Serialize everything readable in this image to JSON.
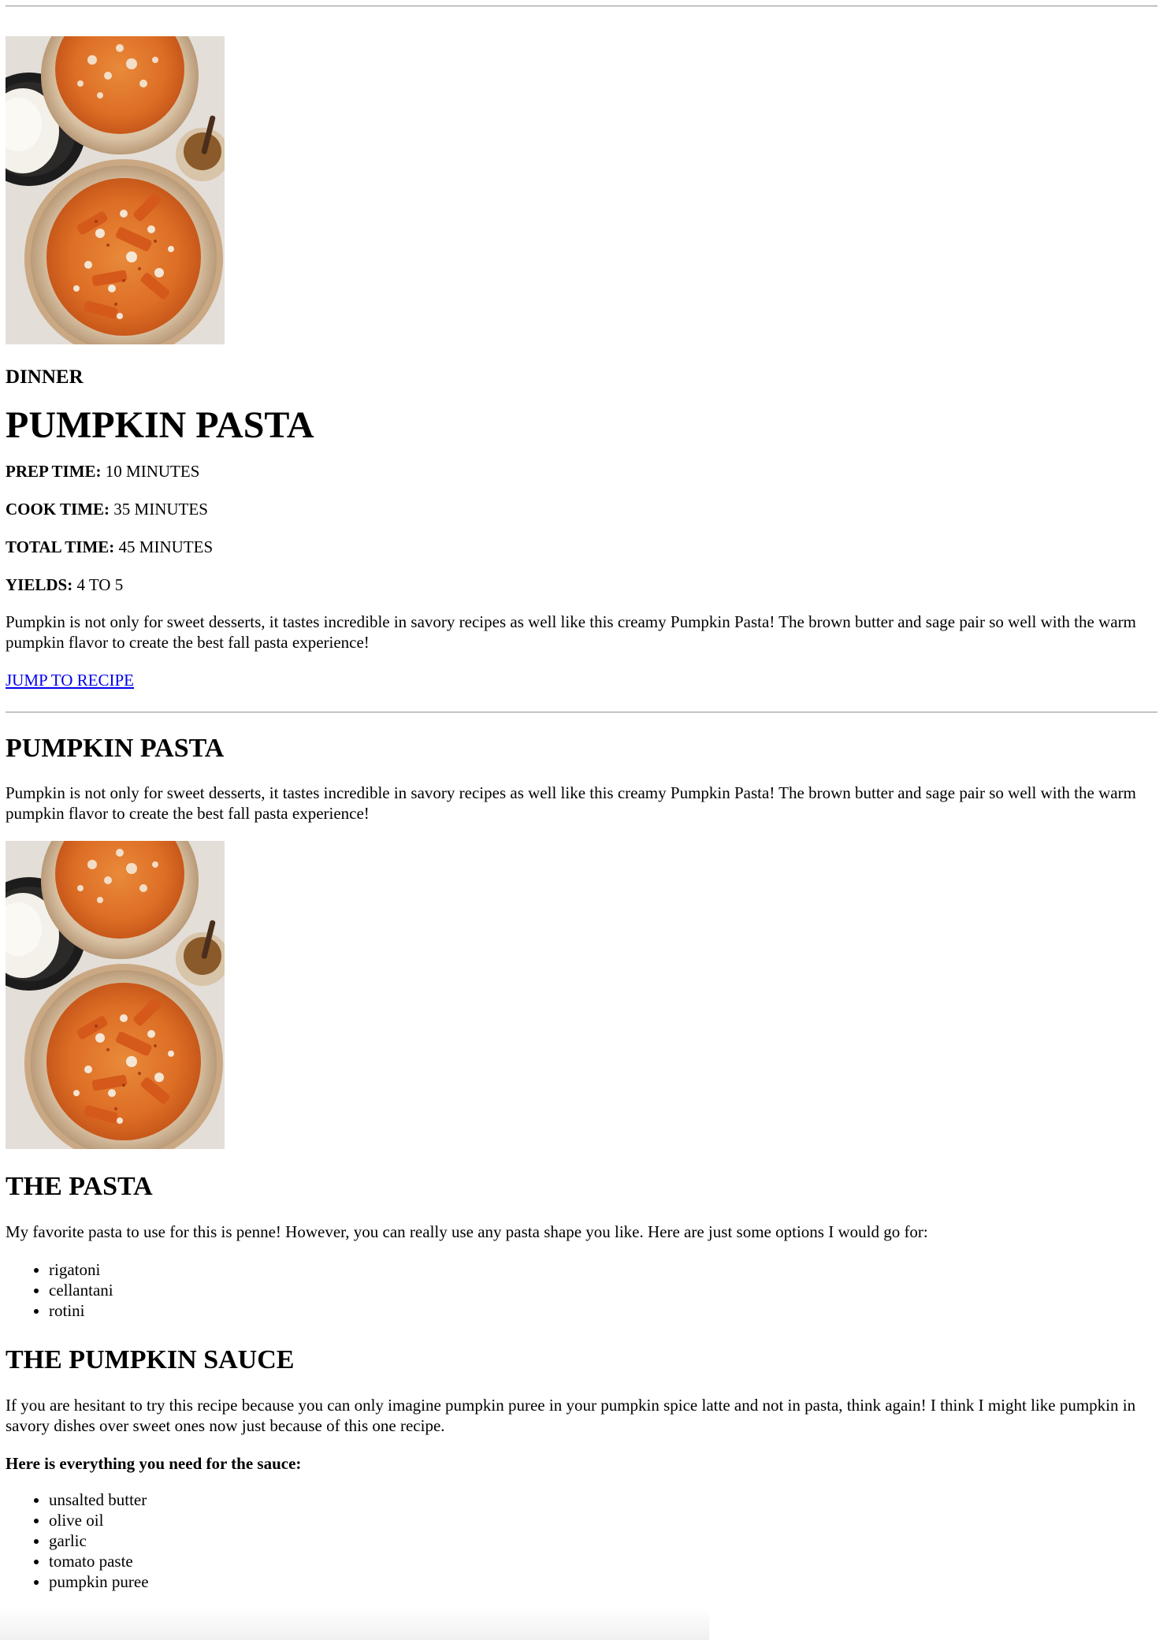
{
  "header": {
    "category": "DINNER",
    "title": "PUMPKIN PASTA"
  },
  "images": {
    "hero_alt": "Pumpkin pasta in bowls",
    "recipe_alt": "Pumpkin pasta in bowls"
  },
  "meta": {
    "prep_label": "PREP TIME:",
    "prep_value": "10 MINUTES",
    "cook_label": "COOK TIME:",
    "cook_value": "35 MINUTES",
    "total_label": "TOTAL TIME:",
    "total_value": "45 MINUTES",
    "yields_label": "YIELDS:",
    "yields_value": "4 TO 5"
  },
  "intro": "Pumpkin is not only for sweet desserts, it tastes incredible in savory recipes as well like this creamy Pumpkin Pasta! The brown butter and sage pair so well with the warm pumpkin flavor to create the best fall pasta experience!",
  "jump_link": "JUMP TO RECIPE",
  "recipe": {
    "title": "PUMPKIN PASTA",
    "intro": "Pumpkin is not only for sweet desserts, it tastes incredible in savory recipes as well like this creamy Pumpkin Pasta! The brown butter and sage pair so well with the warm pumpkin flavor to create the best fall pasta experience!",
    "pasta": {
      "title": "THE PASTA",
      "text": "My favorite pasta to use for this is penne! However, you can really use any pasta shape you like. Here are just some options I would go for:",
      "options": [
        "rigatoni",
        "cellantani",
        "rotini"
      ]
    },
    "sauce": {
      "title": "THE PUMPKIN SAUCE",
      "text": "If you are hesitant to try this recipe because you can only imagine pumpkin puree in your pumpkin spice latte and not in pasta, think again! I think I might like pumpkin in savory dishes over sweet ones now just because of this one recipe.",
      "needs_label": "Here is everything you need for the sauce:",
      "ingredients": [
        "unsalted butter",
        "olive oil",
        "garlic",
        "tomato paste",
        "pumpkin puree"
      ]
    }
  },
  "colors": {
    "link": "#0000ee",
    "text": "#000000",
    "rule": "#9a9a9a"
  }
}
